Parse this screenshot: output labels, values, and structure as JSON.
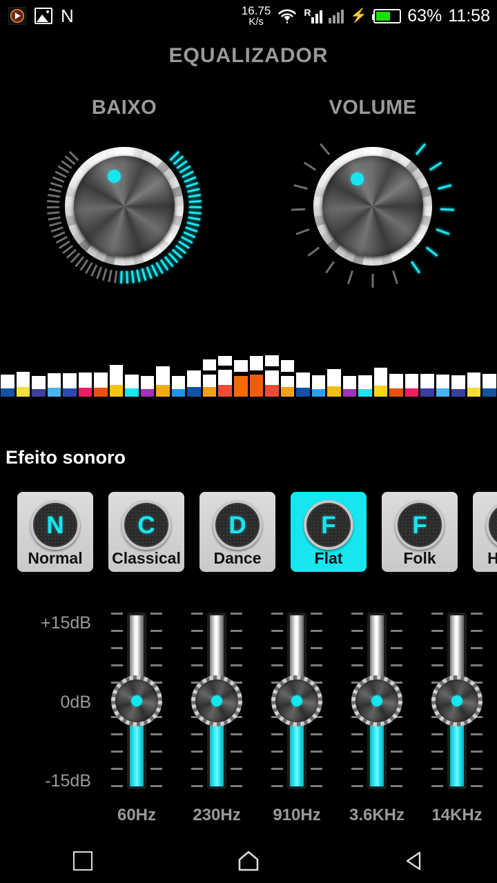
{
  "statusbar": {
    "icons_left": [
      "music-notification-icon",
      "photo-icon",
      "n-letter-icon"
    ],
    "net_speed_value": "16.75",
    "net_speed_unit": "K/s",
    "wifi": "wifi-icon",
    "signal1": "signal-roaming-icon",
    "signal1_label": "R",
    "signal2": "signal-icon",
    "charging": "charging-bolt-icon",
    "battery": "battery-icon",
    "battery_percent": "63%",
    "time": "11:58"
  },
  "header": {
    "title": "EQUALIZADOR"
  },
  "knobs": [
    {
      "name": "bass-knob",
      "label": "BAIXO",
      "value_angle_deg": -18,
      "fill_ratio": 0.52,
      "tick_count": 60,
      "start_angle_deg": -135,
      "sweep_deg": 270,
      "style": "fine",
      "accent": "#17e6f0",
      "inactive": "#6e6e6e"
    },
    {
      "name": "volume-knob",
      "label": "VOLUME",
      "value_angle_deg": -30,
      "fill_ratio": 0.42,
      "tick_count": 17,
      "start_angle_deg": -140,
      "sweep_deg": 280,
      "style": "coarse",
      "accent": "#17e6f0",
      "inactive": "#6e6e6e"
    }
  ],
  "spectrum": {
    "name": "audio-spectrum-visualizer",
    "bar_count": 32,
    "bars": [
      {
        "peak": 0,
        "body": 20,
        "tip": 12,
        "tip_color": "#1552a0"
      },
      {
        "peak": 0,
        "body": 22,
        "tip": 14,
        "tip_color": "#f2de3a"
      },
      {
        "peak": 0,
        "body": 19,
        "tip": 11,
        "tip_color": "#3b3fa0"
      },
      {
        "peak": 0,
        "body": 21,
        "tip": 13,
        "tip_color": "#48b4ef"
      },
      {
        "peak": 0,
        "body": 22,
        "tip": 12,
        "tip_color": "#2e49b5"
      },
      {
        "peak": 0,
        "body": 22,
        "tip": 13,
        "tip_color": "#ea2060"
      },
      {
        "peak": 0,
        "body": 22,
        "tip": 13,
        "tip_color": "#e8510f"
      },
      {
        "peak": 0,
        "body": 29,
        "tip": 17,
        "tip_color": "#fac40d"
      },
      {
        "peak": 0,
        "body": 20,
        "tip": 12,
        "tip_color": "#19e4f0"
      },
      {
        "peak": 0,
        "body": 19,
        "tip": 11,
        "tip_color": "#a32fbd"
      },
      {
        "peak": 0,
        "body": 27,
        "tip": 17,
        "tip_color": "#f4ab12"
      },
      {
        "peak": 0,
        "body": 19,
        "tip": 11,
        "tip_color": "#1f93e8"
      },
      {
        "peak": 0,
        "body": 24,
        "tip": 14,
        "tip_color": "#0f52a8"
      },
      {
        "peak": 16,
        "body": 18,
        "tip": 14,
        "tip_color": "#f4a017"
      },
      {
        "peak": 14,
        "body": 22,
        "tip": 17,
        "tip_color": "#ef4a36"
      },
      {
        "peak": 17,
        "body": 0,
        "tip": 30,
        "tip_color": "#f96a07"
      },
      {
        "peak": 21,
        "body": 0,
        "tip": 32,
        "tip_color": "#f45d0a"
      },
      {
        "peak": 16,
        "body": 21,
        "tip": 17,
        "tip_color": "#ef4a36"
      },
      {
        "peak": 17,
        "body": 16,
        "tip": 14,
        "tip_color": "#f4a017"
      },
      {
        "peak": 0,
        "body": 22,
        "tip": 13,
        "tip_color": "#0f52a8"
      },
      {
        "peak": 0,
        "body": 20,
        "tip": 11,
        "tip_color": "#2da0ef"
      },
      {
        "peak": 0,
        "body": 25,
        "tip": 15,
        "tip_color": "#f4bd14"
      },
      {
        "peak": 0,
        "body": 19,
        "tip": 11,
        "tip_color": "#a32fbd"
      },
      {
        "peak": 0,
        "body": 20,
        "tip": 11,
        "tip_color": "#19e4f0"
      },
      {
        "peak": 0,
        "body": 26,
        "tip": 16,
        "tip_color": "#fad515"
      },
      {
        "peak": 0,
        "body": 21,
        "tip": 12,
        "tip_color": "#e8510f"
      },
      {
        "peak": 0,
        "body": 21,
        "tip": 12,
        "tip_color": "#ea2060"
      },
      {
        "peak": 0,
        "body": 21,
        "tip": 12,
        "tip_color": "#3b3fa0"
      },
      {
        "peak": 0,
        "body": 20,
        "tip": 12,
        "tip_color": "#48b4ef"
      },
      {
        "peak": 0,
        "body": 20,
        "tip": 11,
        "tip_color": "#3b3fa0"
      },
      {
        "peak": 0,
        "body": 22,
        "tip": 13,
        "tip_color": "#f2de3a"
      },
      {
        "peak": 0,
        "body": 21,
        "tip": 12,
        "tip_color": "#1552a0"
      }
    ]
  },
  "effects": {
    "section_label": "Efeito sonoro",
    "selected": "Flat",
    "presets": [
      {
        "letter": "N",
        "label": "Normal",
        "selected": false
      },
      {
        "letter": "C",
        "label": "Classical",
        "selected": false
      },
      {
        "letter": "D",
        "label": "Dance",
        "selected": false
      },
      {
        "letter": "F",
        "label": "Flat",
        "selected": true
      },
      {
        "letter": "F",
        "label": "Folk",
        "selected": false
      },
      {
        "letter": "H",
        "label": "Heavy",
        "selected": false
      }
    ]
  },
  "equalizer": {
    "name": "band-sliders",
    "db_labels": {
      "top": "+15dB",
      "mid": "0dB",
      "bottom": "-15dB"
    },
    "range_db": [
      -15,
      15
    ],
    "bands": [
      {
        "freq": "60Hz",
        "value_db": 0,
        "thumb_pct": 50
      },
      {
        "freq": "230Hz",
        "value_db": 0,
        "thumb_pct": 50
      },
      {
        "freq": "910Hz",
        "value_db": 0,
        "thumb_pct": 50
      },
      {
        "freq": "3.6KHz",
        "value_db": 0,
        "thumb_pct": 50
      },
      {
        "freq": "14KHz",
        "value_db": 0,
        "thumb_pct": 50
      }
    ]
  },
  "navbar": {
    "recents": "recents-square-icon",
    "home": "home-icon",
    "back": "back-triangle-icon"
  },
  "colors": {
    "accent": "#17e6f0",
    "background": "#000000",
    "label_gray": "#9a9a9a",
    "preset_bg": "#d4d4d4"
  }
}
